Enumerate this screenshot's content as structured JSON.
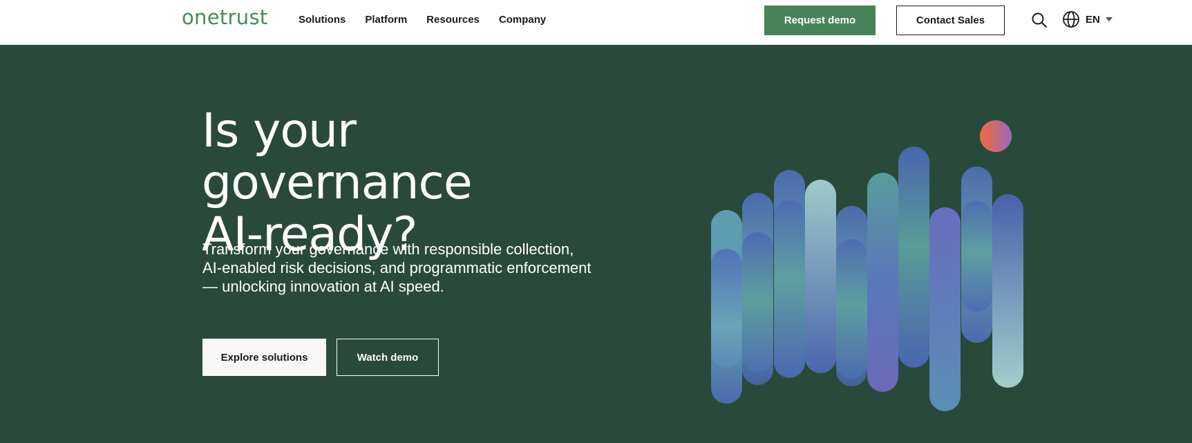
{
  "header": {
    "logo": "onetrust",
    "nav": [
      "Solutions",
      "Platform",
      "Resources",
      "Company"
    ],
    "request_demo": "Request demo",
    "contact_sales": "Contact Sales",
    "language": "EN"
  },
  "hero": {
    "title_line1": "Is your governance",
    "title_line2": "AI-ready?",
    "subtitle": "Transform your governance with responsible collection, AI-enabled risk decisions, and programmatic enforcement — unlocking innovation at AI speed.",
    "cta_primary": "Explore solutions",
    "cta_secondary": "Watch demo"
  },
  "colors": {
    "brand_green": "#47845a",
    "hero_bg": "#294a3b",
    "accent_dot": "#e0664a"
  },
  "icons": {
    "search": "search-icon",
    "language": "globe-icon",
    "dropdown": "caret-down-icon"
  }
}
